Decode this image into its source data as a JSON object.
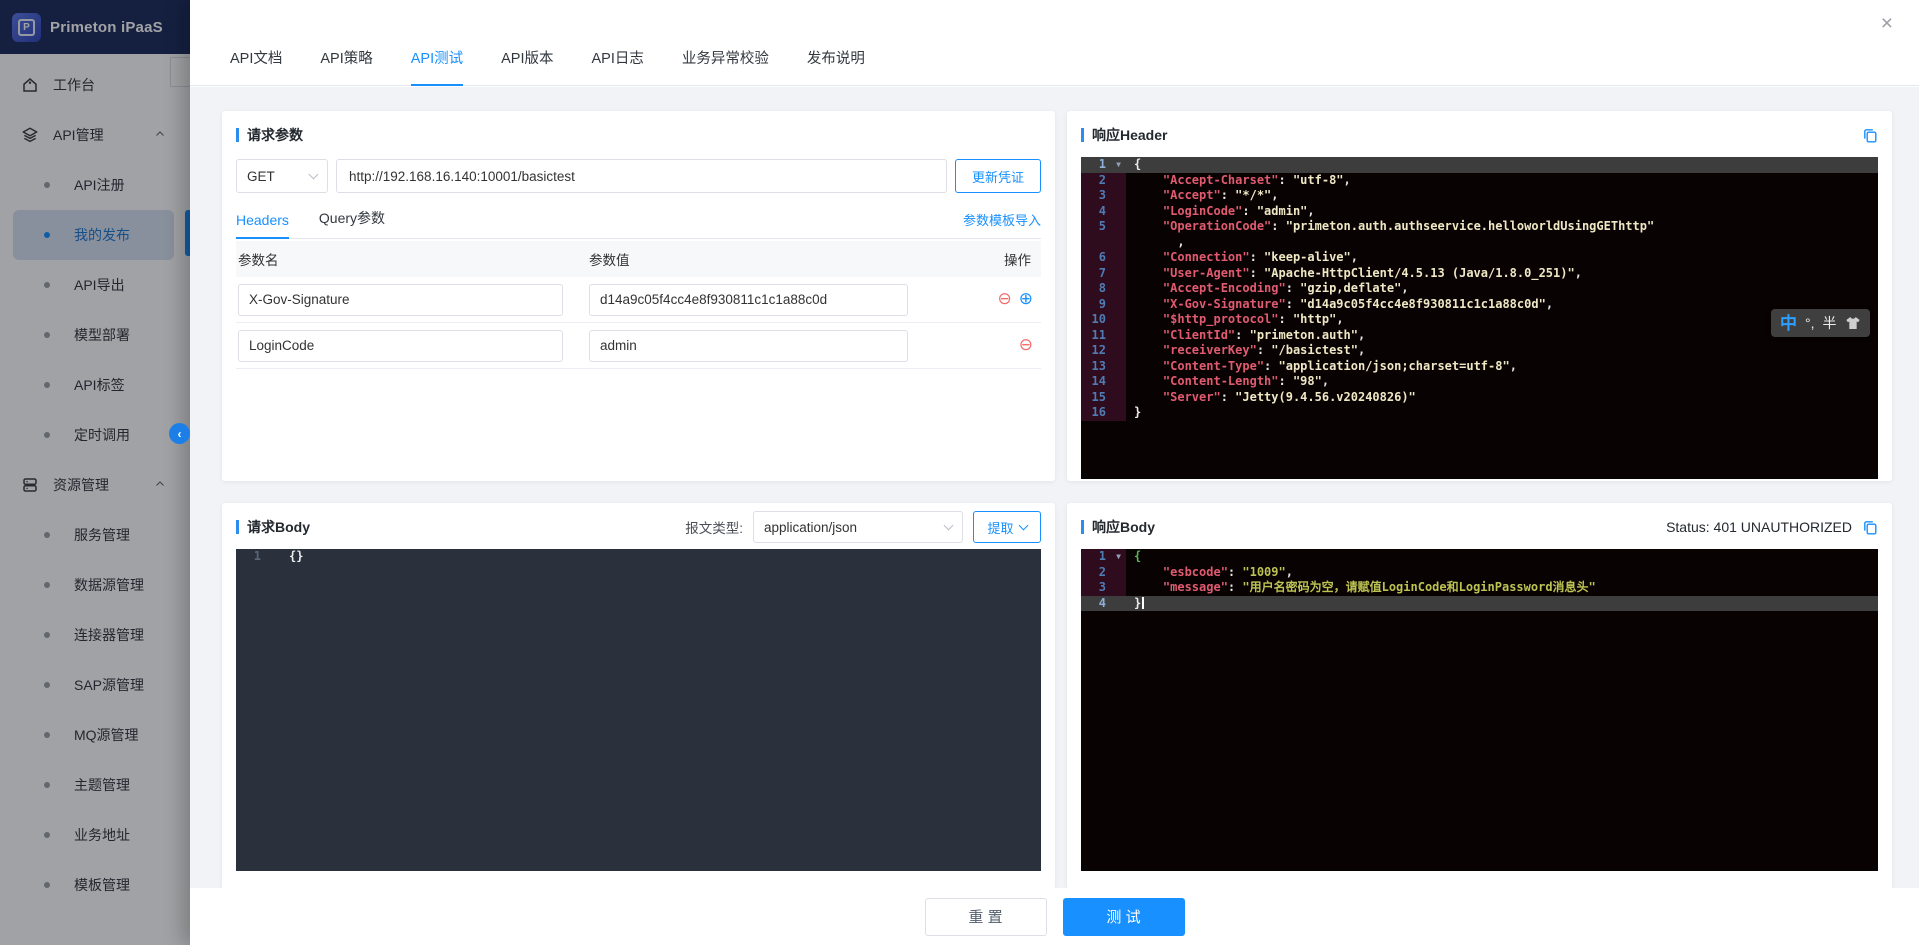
{
  "window": {
    "close_icon": "×"
  },
  "brand": {
    "logo_text": "Primeton iPaaS",
    "logo_letter": "P"
  },
  "sidebar": {
    "items": [
      {
        "label": "工作台",
        "level": "top",
        "icon": "home-icon"
      },
      {
        "label": "API管理",
        "level": "group",
        "icon": "layers-icon",
        "expanded": true
      },
      {
        "label": "API注册",
        "level": "sub"
      },
      {
        "label": "我的发布",
        "level": "sub",
        "active": true
      },
      {
        "label": "API导出",
        "level": "sub"
      },
      {
        "label": "模型部署",
        "level": "sub"
      },
      {
        "label": "API标签",
        "level": "sub"
      },
      {
        "label": "定时调用",
        "level": "sub"
      },
      {
        "label": "资源管理",
        "level": "group",
        "icon": "database-icon",
        "expanded": true
      },
      {
        "label": "服务管理",
        "level": "sub"
      },
      {
        "label": "数据源管理",
        "level": "sub"
      },
      {
        "label": "连接器管理",
        "level": "sub"
      },
      {
        "label": "SAP源管理",
        "level": "sub"
      },
      {
        "label": "MQ源管理",
        "level": "sub"
      },
      {
        "label": "主题管理",
        "level": "sub"
      },
      {
        "label": "业务地址",
        "level": "sub"
      },
      {
        "label": "模板管理",
        "level": "sub"
      }
    ]
  },
  "tabs": {
    "items": [
      {
        "label": "API文档"
      },
      {
        "label": "API策略"
      },
      {
        "label": "API测试",
        "active": true
      },
      {
        "label": "API版本"
      },
      {
        "label": "API日志"
      },
      {
        "label": "业务异常校验"
      },
      {
        "label": "发布说明"
      }
    ]
  },
  "request_params": {
    "title": "请求参数",
    "method": "GET",
    "url": "http://192.168.16.140:10001/basictest",
    "update_credential_label": "更新凭证",
    "subtabs": [
      {
        "label": "Headers",
        "active": true
      },
      {
        "label": "Query参数"
      }
    ],
    "template_import_label": "参数模板导入",
    "table": {
      "columns": [
        "参数名",
        "参数值",
        "操作"
      ],
      "rows": [
        {
          "name": "X-Gov-Signature",
          "value": "d14a9c05f4cc4e8f930811c1c1a88c0d",
          "ops": [
            "remove",
            "add"
          ]
        },
        {
          "name": "LoginCode",
          "value": "admin",
          "ops": [
            "remove"
          ]
        }
      ]
    }
  },
  "request_body": {
    "title": "请求Body",
    "content_type_label": "报文类型:",
    "content_type": "application/json",
    "extract_label": "提取",
    "lines": [
      {
        "n": "1",
        "tokens": [
          [
            "plain",
            "{}"
          ]
        ]
      }
    ]
  },
  "response_header": {
    "title": "响应Header",
    "lines": [
      {
        "n": "1",
        "fold": true,
        "hl": true,
        "tokens": [
          [
            "plain",
            "{"
          ]
        ]
      },
      {
        "n": "2",
        "tokens": [
          [
            "key",
            "    \"Accept-Charset\""
          ],
          [
            "punc",
            ": "
          ],
          [
            "str",
            "\"utf-8\""
          ],
          [
            "punc",
            ","
          ]
        ]
      },
      {
        "n": "3",
        "tokens": [
          [
            "key",
            "    \"Accept\""
          ],
          [
            "punc",
            ": "
          ],
          [
            "str",
            "\"*/*\""
          ],
          [
            "punc",
            ","
          ]
        ]
      },
      {
        "n": "4",
        "tokens": [
          [
            "key",
            "    \"LoginCode\""
          ],
          [
            "punc",
            ": "
          ],
          [
            "str",
            "\"admin\""
          ],
          [
            "punc",
            ","
          ]
        ]
      },
      {
        "n": "5",
        "tokens": [
          [
            "key",
            "    \"OperationCode\""
          ],
          [
            "punc",
            ": "
          ],
          [
            "str",
            "\"primeton.auth.authseervice.helloworldUsingGEThttp\""
          ]
        ]
      },
      {
        "n": "",
        "tokens": [
          [
            "punc",
            "      ,"
          ]
        ]
      },
      {
        "n": "6",
        "tokens": [
          [
            "key",
            "    \"Connection\""
          ],
          [
            "punc",
            ": "
          ],
          [
            "str",
            "\"keep-alive\""
          ],
          [
            "punc",
            ","
          ]
        ]
      },
      {
        "n": "7",
        "tokens": [
          [
            "key",
            "    \"User-Agent\""
          ],
          [
            "punc",
            ": "
          ],
          [
            "str",
            "\"Apache-HttpClient/4.5.13 (Java/1.8.0_251)\""
          ],
          [
            "punc",
            ","
          ]
        ]
      },
      {
        "n": "8",
        "tokens": [
          [
            "key",
            "    \"Accept-Encoding\""
          ],
          [
            "punc",
            ": "
          ],
          [
            "str",
            "\"gzip,deflate\""
          ],
          [
            "punc",
            ","
          ]
        ]
      },
      {
        "n": "9",
        "tokens": [
          [
            "key",
            "    \"X-Gov-Signature\""
          ],
          [
            "punc",
            ": "
          ],
          [
            "str",
            "\"d14a9c05f4cc4e8f930811c1c1a88c0d\""
          ],
          [
            "punc",
            ","
          ]
        ]
      },
      {
        "n": "10",
        "tokens": [
          [
            "key",
            "    \"$http_protocol\""
          ],
          [
            "punc",
            ": "
          ],
          [
            "str",
            "\"http\""
          ],
          [
            "punc",
            ","
          ]
        ]
      },
      {
        "n": "11",
        "tokens": [
          [
            "key",
            "    \"ClientId\""
          ],
          [
            "punc",
            ": "
          ],
          [
            "str",
            "\"primeton.auth\""
          ],
          [
            "punc",
            ","
          ]
        ]
      },
      {
        "n": "12",
        "tokens": [
          [
            "key",
            "    \"receiverKey\""
          ],
          [
            "punc",
            ": "
          ],
          [
            "str",
            "\"/basictest\""
          ],
          [
            "punc",
            ","
          ]
        ]
      },
      {
        "n": "13",
        "tokens": [
          [
            "key",
            "    \"Content-Type\""
          ],
          [
            "punc",
            ": "
          ],
          [
            "str",
            "\"application/json;charset=utf-8\""
          ],
          [
            "punc",
            ","
          ]
        ]
      },
      {
        "n": "14",
        "tokens": [
          [
            "key",
            "    \"Content-Length\""
          ],
          [
            "punc",
            ": "
          ],
          [
            "str",
            "\"98\""
          ],
          [
            "punc",
            ","
          ]
        ]
      },
      {
        "n": "15",
        "tokens": [
          [
            "key",
            "    \"Server\""
          ],
          [
            "punc",
            ": "
          ],
          [
            "str",
            "\"Jetty(9.4.56.v20240826)\""
          ]
        ]
      },
      {
        "n": "16",
        "tokens": [
          [
            "plain",
            "}"
          ]
        ]
      }
    ]
  },
  "response_body": {
    "title": "响应Body",
    "status_text": "Status: 401 UNAUTHORIZED",
    "lines": [
      {
        "n": "1",
        "fold": true,
        "tokens": [
          [
            "green",
            "{"
          ]
        ]
      },
      {
        "n": "2",
        "tokens": [
          [
            "key",
            "    \"esbcode\""
          ],
          [
            "punc",
            ": "
          ],
          [
            "str2",
            "\"1009\""
          ],
          [
            "punc",
            ","
          ]
        ]
      },
      {
        "n": "3",
        "tokens": [
          [
            "key",
            "    \"message\""
          ],
          [
            "punc",
            ": "
          ],
          [
            "str2",
            "\"用户名密码为空，请赋值LoginCode和LoginPassword消息头\""
          ]
        ]
      },
      {
        "n": "4",
        "hl": true,
        "tokens": [
          [
            "plain",
            "}"
          ],
          [
            "caret",
            ""
          ]
        ]
      }
    ]
  },
  "footer": {
    "reset_label": "重 置",
    "test_label": "测 试"
  },
  "ime": {
    "mode": "中",
    "punct": "°,",
    "width": "半"
  },
  "colors": {
    "accent": "#1890ff",
    "danger": "#f56c6c",
    "header_navy": "#1e2e5e",
    "status": "401"
  }
}
